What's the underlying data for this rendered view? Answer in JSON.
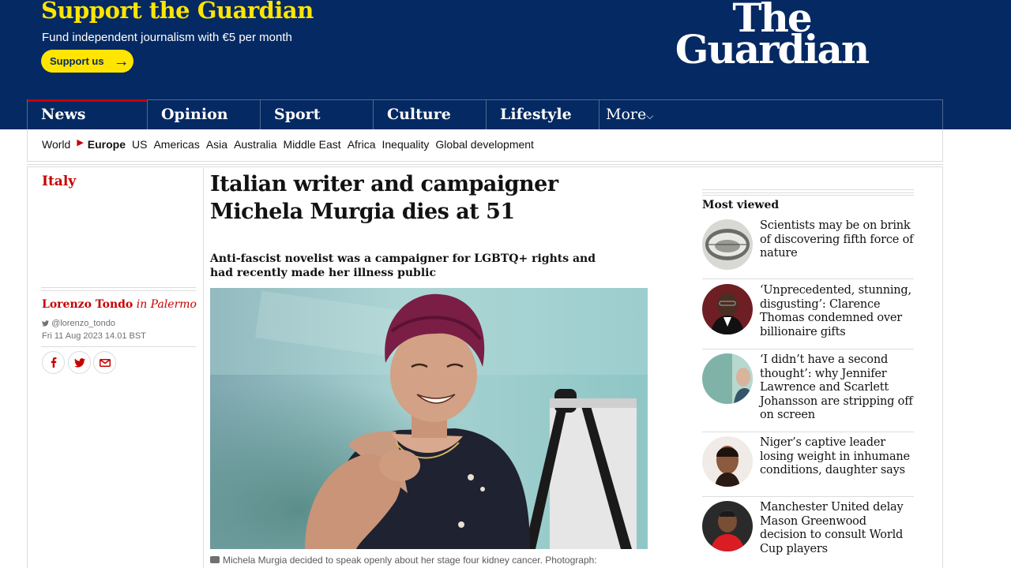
{
  "support": {
    "title": "Support the Guardian",
    "subtitle": "Fund independent journalism with €5 per month",
    "button_label": "Support us",
    "arrow": "→"
  },
  "logo": {
    "line1": "The",
    "line2": "Guardian"
  },
  "pillars": [
    {
      "label": "News"
    },
    {
      "label": "Opinion"
    },
    {
      "label": "Sport"
    },
    {
      "label": "Culture"
    },
    {
      "label": "Lifestyle"
    }
  ],
  "more": {
    "label": "More",
    "chevron": "⌵"
  },
  "subnav": {
    "parent": "World",
    "marker": "▶",
    "current": "Europe",
    "items": [
      "US",
      "Americas",
      "Asia",
      "Australia",
      "Middle East",
      "Africa",
      "Inequality",
      "Global development"
    ]
  },
  "article": {
    "section": "Italy",
    "headline": "Italian writer and campaigner Michela Murgia dies at 51",
    "standfirst": "Anti-fascist novelist was a campaigner for LGBTQ+ rights and had recently made her illness public",
    "author": "Lorenzo Tondo",
    "location": "in Palermo",
    "twitter": "@lorenzo_tondo",
    "date": "Fri 11 Aug 2023 14.01 BST",
    "caption": "Michela Murgia decided to speak openly about her stage four kidney cancer. Photograph:"
  },
  "share": {
    "facebook_icon": "facebook-icon",
    "twitter_icon": "twitter-icon",
    "email_icon": "email-icon"
  },
  "most_viewed": {
    "title": "Most viewed",
    "items": [
      {
        "text": "Scientists may be on brink of discovering fifth force of nature"
      },
      {
        "text": "‘Unprecedented, stunning, disgusting’: Clarence Thomas condemned over billionaire gifts"
      },
      {
        "text": "‘I didn’t have a second thought’: why Jennifer Lawrence and Scarlett Johansson are stripping off on screen"
      },
      {
        "text": "Niger’s captive leader losing weight in inhumane conditions, daughter says"
      },
      {
        "text": "Manchester United delay Mason Greenwood decision to consult World Cup players"
      }
    ]
  },
  "colors": {
    "brand_blue": "#052962",
    "support_yellow": "#ffe500",
    "news_red": "#c70000"
  }
}
